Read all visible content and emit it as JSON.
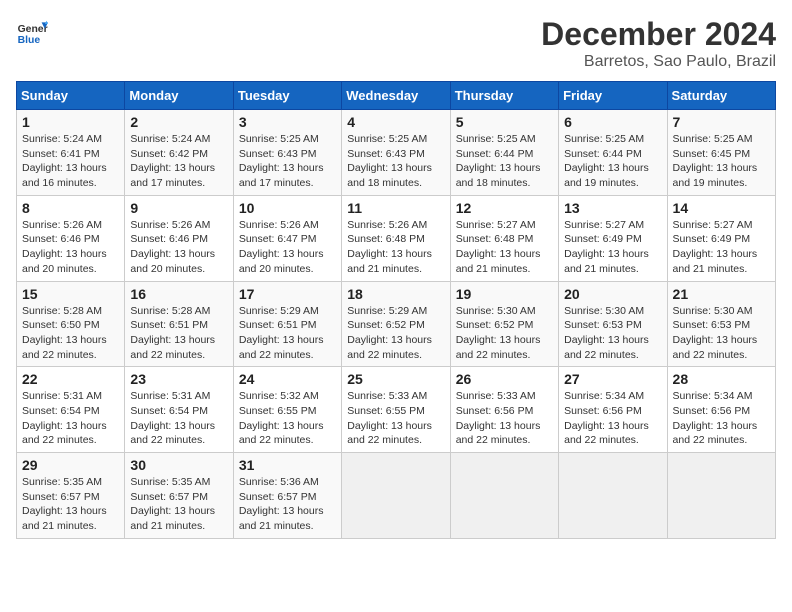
{
  "header": {
    "logo_general": "General",
    "logo_blue": "Blue",
    "title": "December 2024",
    "subtitle": "Barretos, Sao Paulo, Brazil"
  },
  "calendar": {
    "days_of_week": [
      "Sunday",
      "Monday",
      "Tuesday",
      "Wednesday",
      "Thursday",
      "Friday",
      "Saturday"
    ],
    "weeks": [
      [
        {
          "day": "1",
          "rise": "5:24 AM",
          "set": "6:41 PM",
          "daylight": "13 hours and 16 minutes."
        },
        {
          "day": "2",
          "rise": "5:24 AM",
          "set": "6:42 PM",
          "daylight": "13 hours and 17 minutes."
        },
        {
          "day": "3",
          "rise": "5:25 AM",
          "set": "6:43 PM",
          "daylight": "13 hours and 17 minutes."
        },
        {
          "day": "4",
          "rise": "5:25 AM",
          "set": "6:43 PM",
          "daylight": "13 hours and 18 minutes."
        },
        {
          "day": "5",
          "rise": "5:25 AM",
          "set": "6:44 PM",
          "daylight": "13 hours and 18 minutes."
        },
        {
          "day": "6",
          "rise": "5:25 AM",
          "set": "6:44 PM",
          "daylight": "13 hours and 19 minutes."
        },
        {
          "day": "7",
          "rise": "5:25 AM",
          "set": "6:45 PM",
          "daylight": "13 hours and 19 minutes."
        }
      ],
      [
        {
          "day": "8",
          "rise": "5:26 AM",
          "set": "6:46 PM",
          "daylight": "13 hours and 20 minutes."
        },
        {
          "day": "9",
          "rise": "5:26 AM",
          "set": "6:46 PM",
          "daylight": "13 hours and 20 minutes."
        },
        {
          "day": "10",
          "rise": "5:26 AM",
          "set": "6:47 PM",
          "daylight": "13 hours and 20 minutes."
        },
        {
          "day": "11",
          "rise": "5:26 AM",
          "set": "6:48 PM",
          "daylight": "13 hours and 21 minutes."
        },
        {
          "day": "12",
          "rise": "5:27 AM",
          "set": "6:48 PM",
          "daylight": "13 hours and 21 minutes."
        },
        {
          "day": "13",
          "rise": "5:27 AM",
          "set": "6:49 PM",
          "daylight": "13 hours and 21 minutes."
        },
        {
          "day": "14",
          "rise": "5:27 AM",
          "set": "6:49 PM",
          "daylight": "13 hours and 21 minutes."
        }
      ],
      [
        {
          "day": "15",
          "rise": "5:28 AM",
          "set": "6:50 PM",
          "daylight": "13 hours and 22 minutes."
        },
        {
          "day": "16",
          "rise": "5:28 AM",
          "set": "6:51 PM",
          "daylight": "13 hours and 22 minutes."
        },
        {
          "day": "17",
          "rise": "5:29 AM",
          "set": "6:51 PM",
          "daylight": "13 hours and 22 minutes."
        },
        {
          "day": "18",
          "rise": "5:29 AM",
          "set": "6:52 PM",
          "daylight": "13 hours and 22 minutes."
        },
        {
          "day": "19",
          "rise": "5:30 AM",
          "set": "6:52 PM",
          "daylight": "13 hours and 22 minutes."
        },
        {
          "day": "20",
          "rise": "5:30 AM",
          "set": "6:53 PM",
          "daylight": "13 hours and 22 minutes."
        },
        {
          "day": "21",
          "rise": "5:30 AM",
          "set": "6:53 PM",
          "daylight": "13 hours and 22 minutes."
        }
      ],
      [
        {
          "day": "22",
          "rise": "5:31 AM",
          "set": "6:54 PM",
          "daylight": "13 hours and 22 minutes."
        },
        {
          "day": "23",
          "rise": "5:31 AM",
          "set": "6:54 PM",
          "daylight": "13 hours and 22 minutes."
        },
        {
          "day": "24",
          "rise": "5:32 AM",
          "set": "6:55 PM",
          "daylight": "13 hours and 22 minutes."
        },
        {
          "day": "25",
          "rise": "5:33 AM",
          "set": "6:55 PM",
          "daylight": "13 hours and 22 minutes."
        },
        {
          "day": "26",
          "rise": "5:33 AM",
          "set": "6:56 PM",
          "daylight": "13 hours and 22 minutes."
        },
        {
          "day": "27",
          "rise": "5:34 AM",
          "set": "6:56 PM",
          "daylight": "13 hours and 22 minutes."
        },
        {
          "day": "28",
          "rise": "5:34 AM",
          "set": "6:56 PM",
          "daylight": "13 hours and 22 minutes."
        }
      ],
      [
        {
          "day": "29",
          "rise": "5:35 AM",
          "set": "6:57 PM",
          "daylight": "13 hours and 21 minutes."
        },
        {
          "day": "30",
          "rise": "5:35 AM",
          "set": "6:57 PM",
          "daylight": "13 hours and 21 minutes."
        },
        {
          "day": "31",
          "rise": "5:36 AM",
          "set": "6:57 PM",
          "daylight": "13 hours and 21 minutes."
        },
        null,
        null,
        null,
        null
      ]
    ]
  }
}
